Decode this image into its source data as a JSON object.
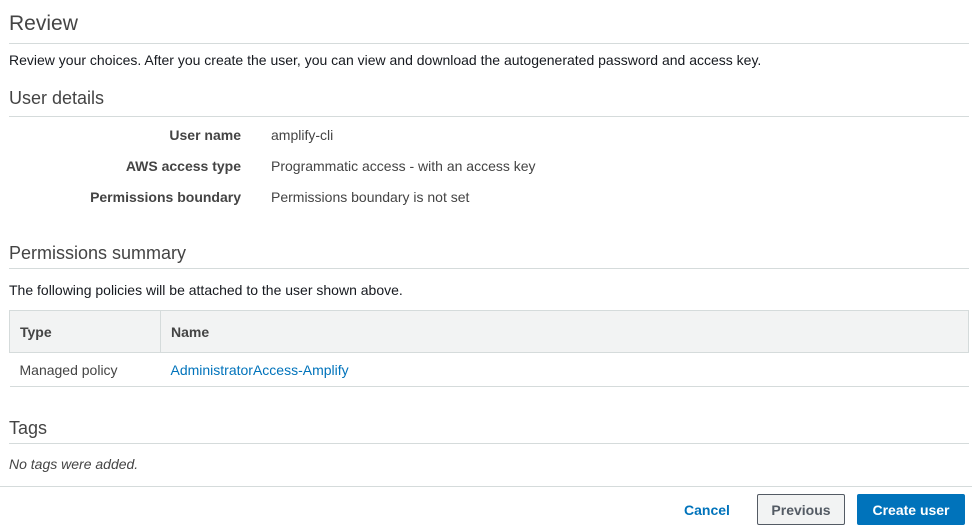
{
  "review": {
    "title": "Review",
    "description": "Review your choices. After you create the user, you can view and download the autogenerated password and access key."
  },
  "user_details": {
    "title": "User details",
    "rows": [
      {
        "label": "User name",
        "value": "amplify-cli"
      },
      {
        "label": "AWS access type",
        "value": "Programmatic access - with an access key"
      },
      {
        "label": "Permissions boundary",
        "value": "Permissions boundary is not set"
      }
    ]
  },
  "permissions_summary": {
    "title": "Permissions summary",
    "description": "The following policies will be attached to the user shown above.",
    "columns": [
      "Type",
      "Name"
    ],
    "rows": [
      {
        "type": "Managed policy",
        "name": "AdministratorAccess-Amplify"
      }
    ]
  },
  "tags": {
    "title": "Tags",
    "empty_text": "No tags were added."
  },
  "footer": {
    "cancel_label": "Cancel",
    "previous_label": "Previous",
    "create_label": "Create user"
  },
  "colors": {
    "accent": "#0073bb",
    "primary_button": "#0073bb",
    "divider": "#d5dbdb",
    "table_header_bg": "#f2f3f3"
  }
}
